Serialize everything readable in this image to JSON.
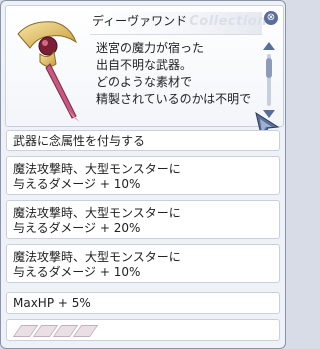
{
  "item": {
    "name": "ディーヴァワンド",
    "watermark": "Collection",
    "description": [
      "迷宮の魔力が宿った",
      "出自不明な武器。",
      "どのような素材で",
      "精製されているのかは不明で"
    ],
    "close_glyph": "⊗"
  },
  "properties": {
    "element": "武器に念属性を付与する",
    "magic_bonus_1": [
      "魔法攻撃時、大型モンスターに",
      "与えるダメージ + 10%"
    ],
    "magic_bonus_2": [
      "魔法攻撃時、大型モンスターに",
      "与えるダメージ + 20%"
    ],
    "magic_bonus_3": [
      "魔法攻撃時、大型モンスターに",
      "与えるダメージ + 10%"
    ],
    "maxhp": "MaxHP + 5%"
  },
  "slots": {
    "count": 4,
    "color": "#e9dfe4"
  },
  "icons": {
    "close": "close-icon",
    "scroll_up": "scroll-up-icon",
    "scroll_down": "scroll-down-icon",
    "cursor": "mouse-cursor-icon",
    "item": "wand-icon"
  },
  "colors": {
    "accent": "#5a6f98",
    "panel": "#eef1f6",
    "border": "#c9cfdc"
  }
}
